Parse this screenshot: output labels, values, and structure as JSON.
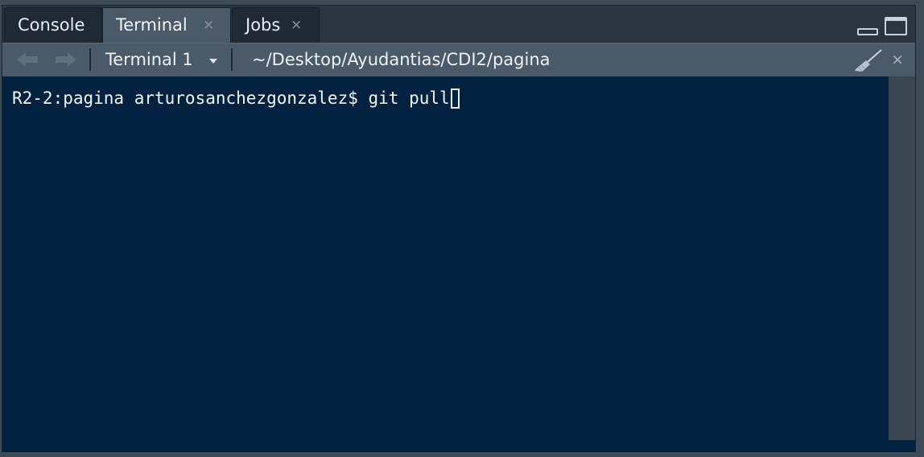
{
  "tabs": [
    {
      "label": "Console",
      "closable": false,
      "active": false
    },
    {
      "label": "Terminal",
      "closable": true,
      "active": true
    },
    {
      "label": "Jobs",
      "closable": true,
      "active": false
    }
  ],
  "tab_close_glyph": "×",
  "toolbar": {
    "terminal_select": "Terminal 1",
    "cwd": "~/Desktop/Ayudantias/CDI2/pagina",
    "close_glyph": "×"
  },
  "terminal": {
    "prompt": "R2-2:pagina arturosanchezgonzalez$ ",
    "command": "git pull"
  },
  "icons": {
    "back": "back-arrow-icon",
    "forward": "forward-arrow-icon",
    "clear": "broom-icon",
    "minimize": "minimize-pane-icon",
    "maximize": "maximize-pane-icon"
  },
  "colors": {
    "terminal_bg": "#00213f",
    "toolbar_bg": "#4b5a68",
    "active_tab_bg": "#4b5a68",
    "tab_bg": "#1f2a34"
  }
}
